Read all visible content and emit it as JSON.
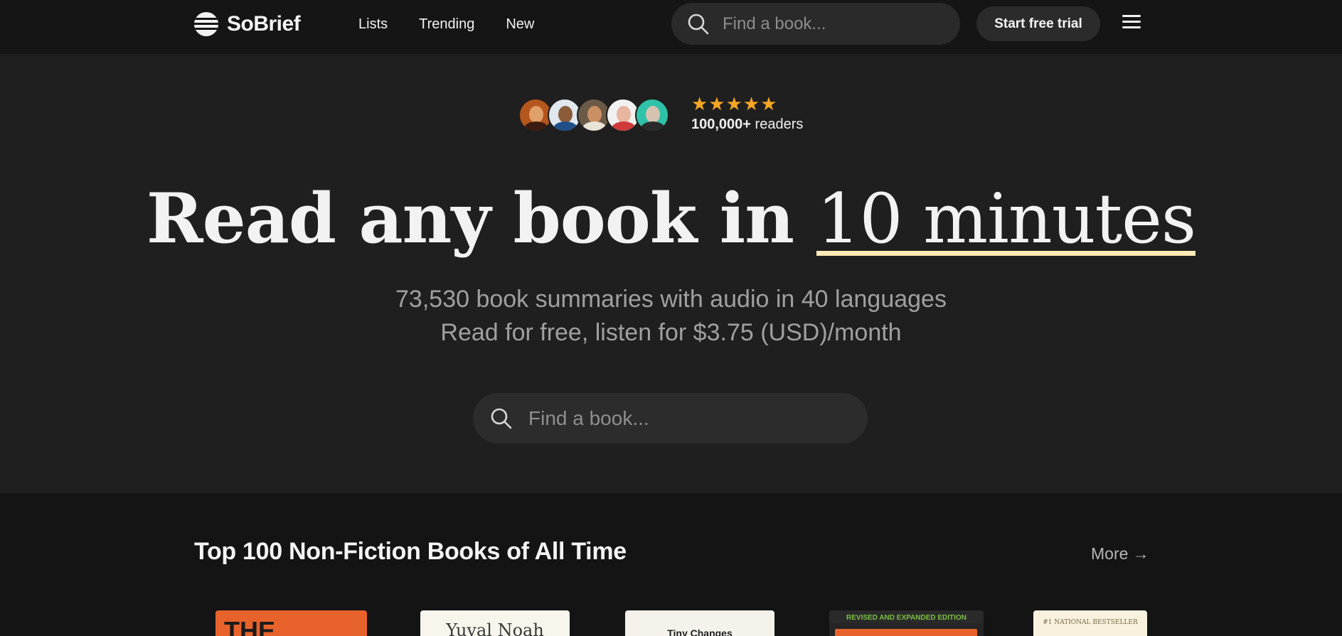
{
  "header": {
    "logo_text": "SoBrief",
    "nav": [
      "Lists",
      "Trending",
      "New"
    ],
    "search_placeholder": "Find a book...",
    "trial_label": "Start free trial"
  },
  "hero": {
    "rating_stars": "★★★★★",
    "readers_count": "100,000+",
    "readers_label": "readers",
    "headline_bold": "Read any book in",
    "headline_highlight": "10 minutes",
    "subtitle_line1": "73,530 book summaries with audio in 40 languages",
    "subtitle_line2": "Read for free, listen for $3.75 (USD)/month",
    "search_placeholder": "Find a book..."
  },
  "section": {
    "title": "Top 100 Non-Fiction Books of All Time",
    "more_label": "More →"
  },
  "books": [
    {
      "cover_text": "THE"
    },
    {
      "cover_text": "Yuval Noah"
    },
    {
      "cover_text": "Tiny Changes"
    },
    {
      "cover_text": "REVISED AND EXPANDED EDITION"
    },
    {
      "cover_text": "#1 NATIONAL BESTSELLER"
    }
  ],
  "colors": {
    "accent_star": "#f5a623",
    "highlight_underline": "#fcebb6",
    "page_bg": "#141414",
    "hero_bg": "#1f1f1f"
  }
}
